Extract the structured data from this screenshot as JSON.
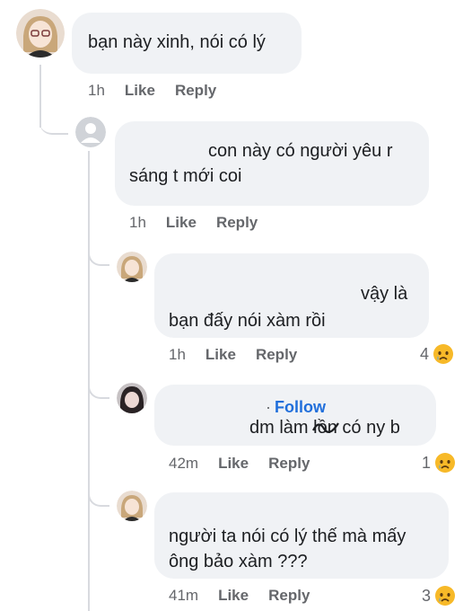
{
  "comments": [
    {
      "lines": [
        "bạn này xinh, nói có lý"
      ],
      "time": "1h",
      "like": "Like",
      "reply": "Reply"
    },
    {
      "lines": [
        "con này có người yêu r",
        "sáng t mới coi"
      ],
      "time": "1h",
      "like": "Like",
      "reply": "Reply"
    },
    {
      "lines": [
        "vậy là",
        "bạn đấy nói xàm rồi"
      ],
      "time": "1h",
      "like": "Like",
      "reply": "Reply",
      "reaction_count": "4",
      "reaction_icon": "sad-face-icon"
    },
    {
      "follow_dot": "·",
      "follow": "Follow",
      "lines_a": "dm làm ",
      "censored": "lồn",
      "lines_b": " có ny b",
      "time": "42m",
      "like": "Like",
      "reply": "Reply",
      "reaction_count": "1",
      "reaction_icon": "sad-face-icon"
    },
    {
      "lines": [
        "người ta nói có lý thế mà mấy",
        "ông bảo xàm ???"
      ],
      "time": "41m",
      "like": "Like",
      "reply": "Reply",
      "reaction_count": "3",
      "reaction_icon": "sad-face-icon"
    }
  ],
  "colors": {
    "bubble": "#f0f2f5",
    "meta": "#65676b",
    "follow": "#216fdb",
    "emoji": "#f7b928"
  }
}
